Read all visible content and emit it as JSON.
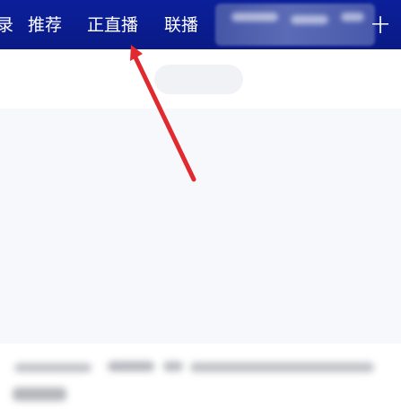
{
  "top_nav": {
    "partial_tab": "录",
    "tabs": [
      "推荐",
      "正直播",
      "联播"
    ],
    "edge_glyph": "十"
  },
  "annotation": {
    "arrow_color": "#e02a2f"
  },
  "colors": {
    "topbar": "#0b1f9a",
    "content_bg": "#f7f8fb"
  }
}
